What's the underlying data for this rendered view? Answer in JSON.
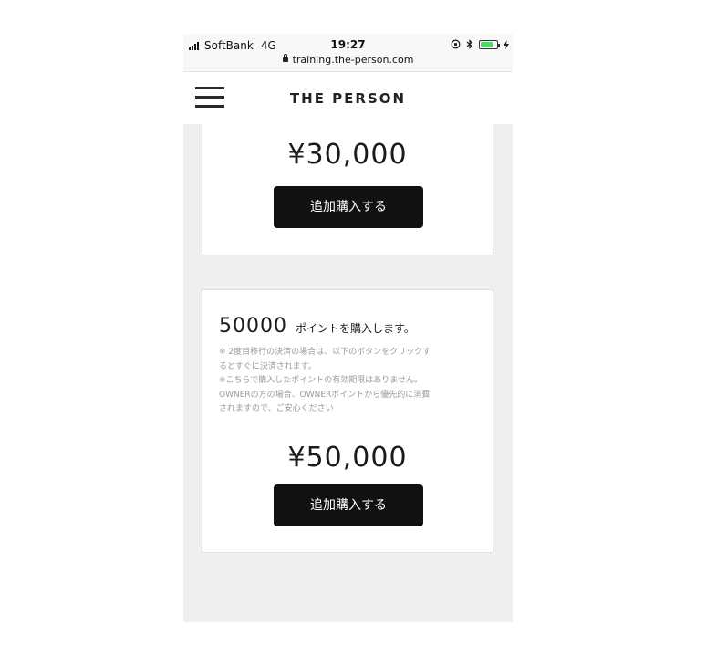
{
  "status_bar": {
    "carrier": "SoftBank",
    "network": "4G",
    "time": "19:27",
    "url": "training.the-person.com",
    "battery_color": "#4cd964"
  },
  "header": {
    "brand": "THE PERSON",
    "menu_icon": "hamburger-menu-icon"
  },
  "cards": [
    {
      "price": "¥30,000",
      "button_label": "追加購入する"
    },
    {
      "points": "50000",
      "points_text": "ポイントを購入します。",
      "notice_lines": [
        "※ 2度目移行の決済の場合は、以下のボタンをクリックす",
        "るとすぐに決済されます。",
        "※こちらで購入したポイントの有効期限はありません。",
        "OWNERの方の場合、OWNERポイントから優先的に消費",
        "されますので、ご安心ください"
      ],
      "price": "¥50,000",
      "button_label": "追加購入する"
    }
  ],
  "colors": {
    "button_bg": "#111111",
    "page_bg": "#efefef",
    "card_bg": "#ffffff"
  }
}
